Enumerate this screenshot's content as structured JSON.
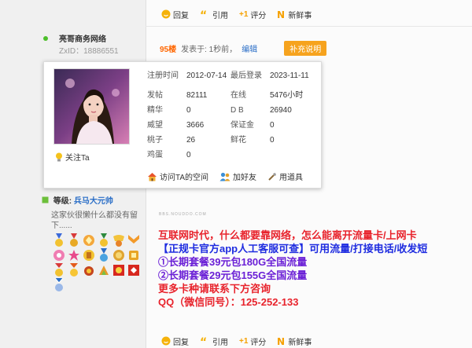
{
  "post_actions": {
    "reply": "回复",
    "quote": "引用",
    "rate_prefix": "+1",
    "rate": "评分",
    "new_thread": "新鲜事"
  },
  "user": {
    "name": "亮哥商务网络",
    "zxid": "ZxID：18886551",
    "rank_label": "等级:",
    "rank_value": "兵马大元帅",
    "signature": "这家伙很懒什么都没有留下......",
    "online_color": "#4dbf2a"
  },
  "post": {
    "floor": "95楼",
    "posted": "发表于: 1秒前，",
    "edit": "编辑",
    "supplement": "补充说明"
  },
  "card": {
    "register_label": "注册时间",
    "register_value": "2012-07-14",
    "last_login_label": "最后登录",
    "last_login_value": "2023-11-11",
    "stats": [
      {
        "l1": "发帖",
        "v1": "82111",
        "l2": "在线",
        "v2": "5476小时"
      },
      {
        "l1": "精华",
        "v1": "0",
        "l2": "D B",
        "v2": "26940"
      },
      {
        "l1": "威望",
        "v1": "3666",
        "l2": "保证金",
        "v2": "0"
      },
      {
        "l1": "桃子",
        "v1": "26",
        "l2": "鲜花",
        "v2": "0"
      },
      {
        "l1": "鸡蛋",
        "v1": "0",
        "l2": "",
        "v2": ""
      }
    ],
    "follow": "关注Ta",
    "visit_space": "访问TA的空间",
    "add_friend": "加好友",
    "use_tool": "用道具"
  },
  "ad": {
    "watermark": "BBS.NOUDDO.COM",
    "line1": "互联网时代，什么都要靠网络，怎么能离开流量卡/上网卡",
    "line2": "【正规卡官方app人工客服可查】可用流量/打接电话/收发短",
    "line3": "①长期套餐39元包180G全国流量",
    "line4": "②长期套餐29元包155G全国流量",
    "line5": "更多卡种请联系下方咨询",
    "line6": "QQ（微信同号）：125-252-133"
  },
  "colors": {
    "accent_orange": "#f60",
    "link_blue": "#2a6ec7",
    "button_orange": "#f6a31e",
    "ad_red": "#e8232c",
    "ad_blue": "#1e2ce0",
    "ad_violet": "#6a1fd6"
  },
  "icons": [
    "reply-icon",
    "quote-icon",
    "new-thread-icon",
    "bulb-icon",
    "home-icon",
    "add-friend-icon",
    "tool-icon"
  ]
}
